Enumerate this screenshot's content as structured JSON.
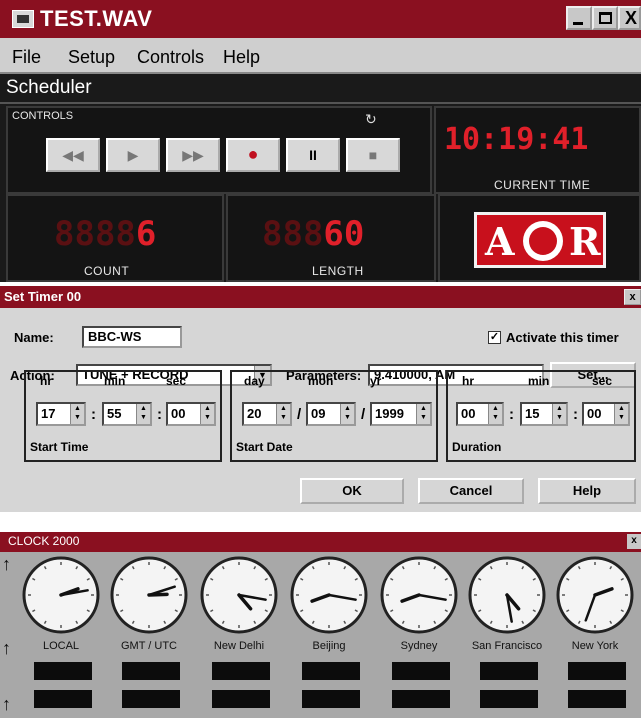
{
  "main": {
    "title": "TEST.WAV",
    "window_buttons": {
      "close": "X"
    },
    "menu": [
      "File",
      "Setup",
      "Controls",
      "Help"
    ],
    "scheduler_label": "Scheduler",
    "controls_label": "CONTROLS",
    "transport": [
      {
        "icon": "rewind-icon",
        "glyph": "◀◀"
      },
      {
        "icon": "play-icon",
        "glyph": "▶"
      },
      {
        "icon": "forward-icon",
        "glyph": "▶▶"
      },
      {
        "icon": "record-icon",
        "glyph": "●"
      },
      {
        "icon": "pause-icon",
        "glyph": "II"
      },
      {
        "icon": "stop-icon",
        "glyph": "■"
      }
    ],
    "current_time": "10:19:41",
    "current_time_label": "CURRENT TIME",
    "count_value": "6",
    "count_label": "COUNT",
    "length_value": "60",
    "length_label": "LENGTH",
    "logo": {
      "a": "A",
      "r": "R"
    },
    "accent_color": "#e0202a",
    "titlebar_color": "#8a1020"
  },
  "set_timer": {
    "title": "Set Timer 00",
    "close": "x",
    "name_label": "Name:",
    "name_value": "BBC-WS",
    "activate_label": "Activate this timer",
    "activate_checked": true,
    "action_label": "Action:",
    "action_value": "TUNE + RECORD",
    "parameters_label": "Parameters:",
    "parameters_value": "9.410000, AM",
    "set_button": "Set...",
    "start_time": {
      "hr_label": "hr",
      "min_label": "min",
      "sec_label": "sec",
      "hr": "17",
      "min": "55",
      "sec": "00",
      "caption": "Start Time"
    },
    "start_date": {
      "day_label": "day",
      "mon_label": "mon",
      "yr_label": "yr",
      "day": "20",
      "mon": "09",
      "yr": "1999",
      "caption": "Start Date"
    },
    "duration": {
      "hr_label": "hr",
      "min_label": "min",
      "sec_label": "sec",
      "hr": "00",
      "min": "15",
      "sec": "00",
      "caption": "Duration"
    },
    "separators": {
      "time": ":",
      "date": "/"
    },
    "ok_button": "OK",
    "cancel_button": "Cancel",
    "help_button": "Help"
  },
  "clock": {
    "title": "CLOCK 2000",
    "close": "x",
    "clocks": [
      {
        "label": "LOCAL"
      },
      {
        "label": "GMT / UTC"
      },
      {
        "label": "New Delhi"
      },
      {
        "label": "Beijing"
      },
      {
        "label": "Sydney"
      },
      {
        "label": "San Francisco"
      },
      {
        "label": "New York"
      }
    ]
  }
}
